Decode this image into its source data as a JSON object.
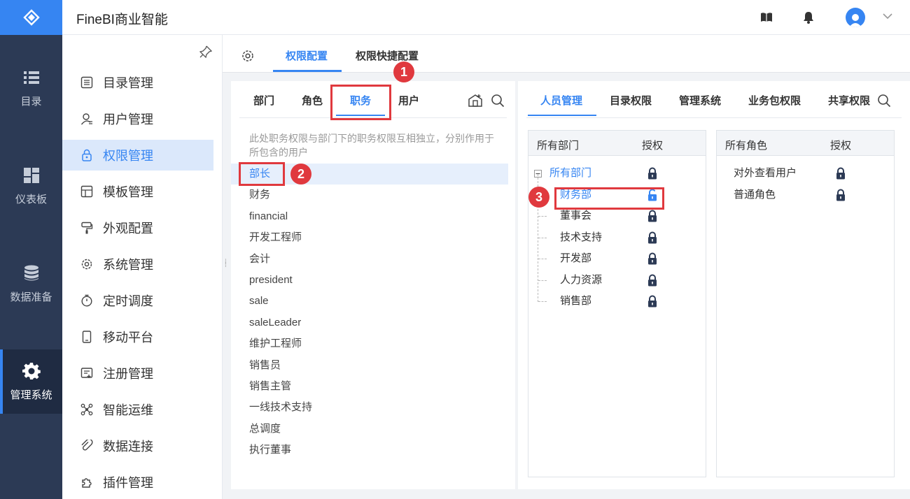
{
  "header": {
    "app_title": "FineBI商业智能"
  },
  "rail": [
    {
      "label": "目录",
      "icon": "list-icon"
    },
    {
      "label": "仪表板",
      "icon": "dashboard-icon"
    },
    {
      "label": "数据准备",
      "icon": "database-icon"
    },
    {
      "label": "管理系统",
      "icon": "gear-icon",
      "active": true
    }
  ],
  "subnav": [
    {
      "label": "目录管理",
      "icon": "catalog-icon"
    },
    {
      "label": "用户管理",
      "icon": "user-icon"
    },
    {
      "label": "权限管理",
      "icon": "lock-icon",
      "active": true
    },
    {
      "label": "模板管理",
      "icon": "template-icon"
    },
    {
      "label": "外观配置",
      "icon": "brush-icon"
    },
    {
      "label": "系统管理",
      "icon": "settings-icon"
    },
    {
      "label": "定时调度",
      "icon": "timer-icon"
    },
    {
      "label": "移动平台",
      "icon": "mobile-icon"
    },
    {
      "label": "注册管理",
      "icon": "register-icon"
    },
    {
      "label": "智能运维",
      "icon": "ops-icon"
    },
    {
      "label": "数据连接",
      "icon": "link-icon"
    },
    {
      "label": "插件管理",
      "icon": "plugin-icon"
    }
  ],
  "main_tabs": {
    "config": "权限配置",
    "quick": "权限快捷配置"
  },
  "left_tabs": {
    "dept": "部门",
    "role": "角色",
    "position": "职务",
    "user": "用户"
  },
  "position_hint": "此处职务权限与部门下的职务权限互相独立，分别作用于所包含的用户",
  "positions": [
    "部长",
    "财务",
    "financial",
    "开发工程师",
    "会计",
    "president",
    "sale",
    "saleLeader",
    "维护工程师",
    "销售员",
    "销售主管",
    "一线技术支持",
    "总调度",
    "执行董事"
  ],
  "right_tabs": {
    "people": "人员管理",
    "catalog": "目录权限",
    "manage": "管理系统",
    "package": "业务包权限",
    "share": "共享权限"
  },
  "dept_box": {
    "head_name": "所有部门",
    "head_auth": "授权",
    "root": "所有部门",
    "children": [
      "财务部",
      "董事会",
      "技术支持",
      "开发部",
      "人力资源",
      "销售部"
    ]
  },
  "role_box": {
    "head_name": "所有角色",
    "head_auth": "授权",
    "roles": [
      "对外查看用户",
      "普通角色"
    ]
  },
  "badges": [
    "1",
    "2",
    "3"
  ],
  "colors": {
    "accent": "#3685f2",
    "rail": "#2c3a55",
    "annotation": "#e0393e"
  }
}
